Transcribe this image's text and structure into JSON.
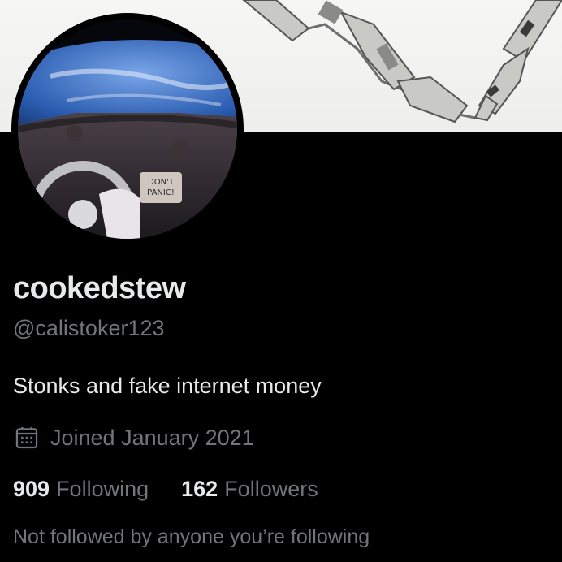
{
  "banner": {
    "description_icon": "robot-arm-banner"
  },
  "avatar": {
    "dashboard_text_line1": "DON'T",
    "dashboard_text_line2": "PANIC!"
  },
  "profile": {
    "display_name": "cookedstew",
    "handle": "@calistoker123",
    "bio": "Stonks and fake internet money",
    "joined": "Joined January 2021",
    "following_count": "909",
    "following_label": "Following",
    "followers_count": "162",
    "followers_label": "Followers",
    "not_followed_text": "Not followed by anyone you’re following"
  },
  "colors": {
    "background": "#000000",
    "primary_text": "#e7e9ea",
    "secondary_text": "#71767b"
  },
  "icons": {
    "joined": "calendar-icon"
  }
}
